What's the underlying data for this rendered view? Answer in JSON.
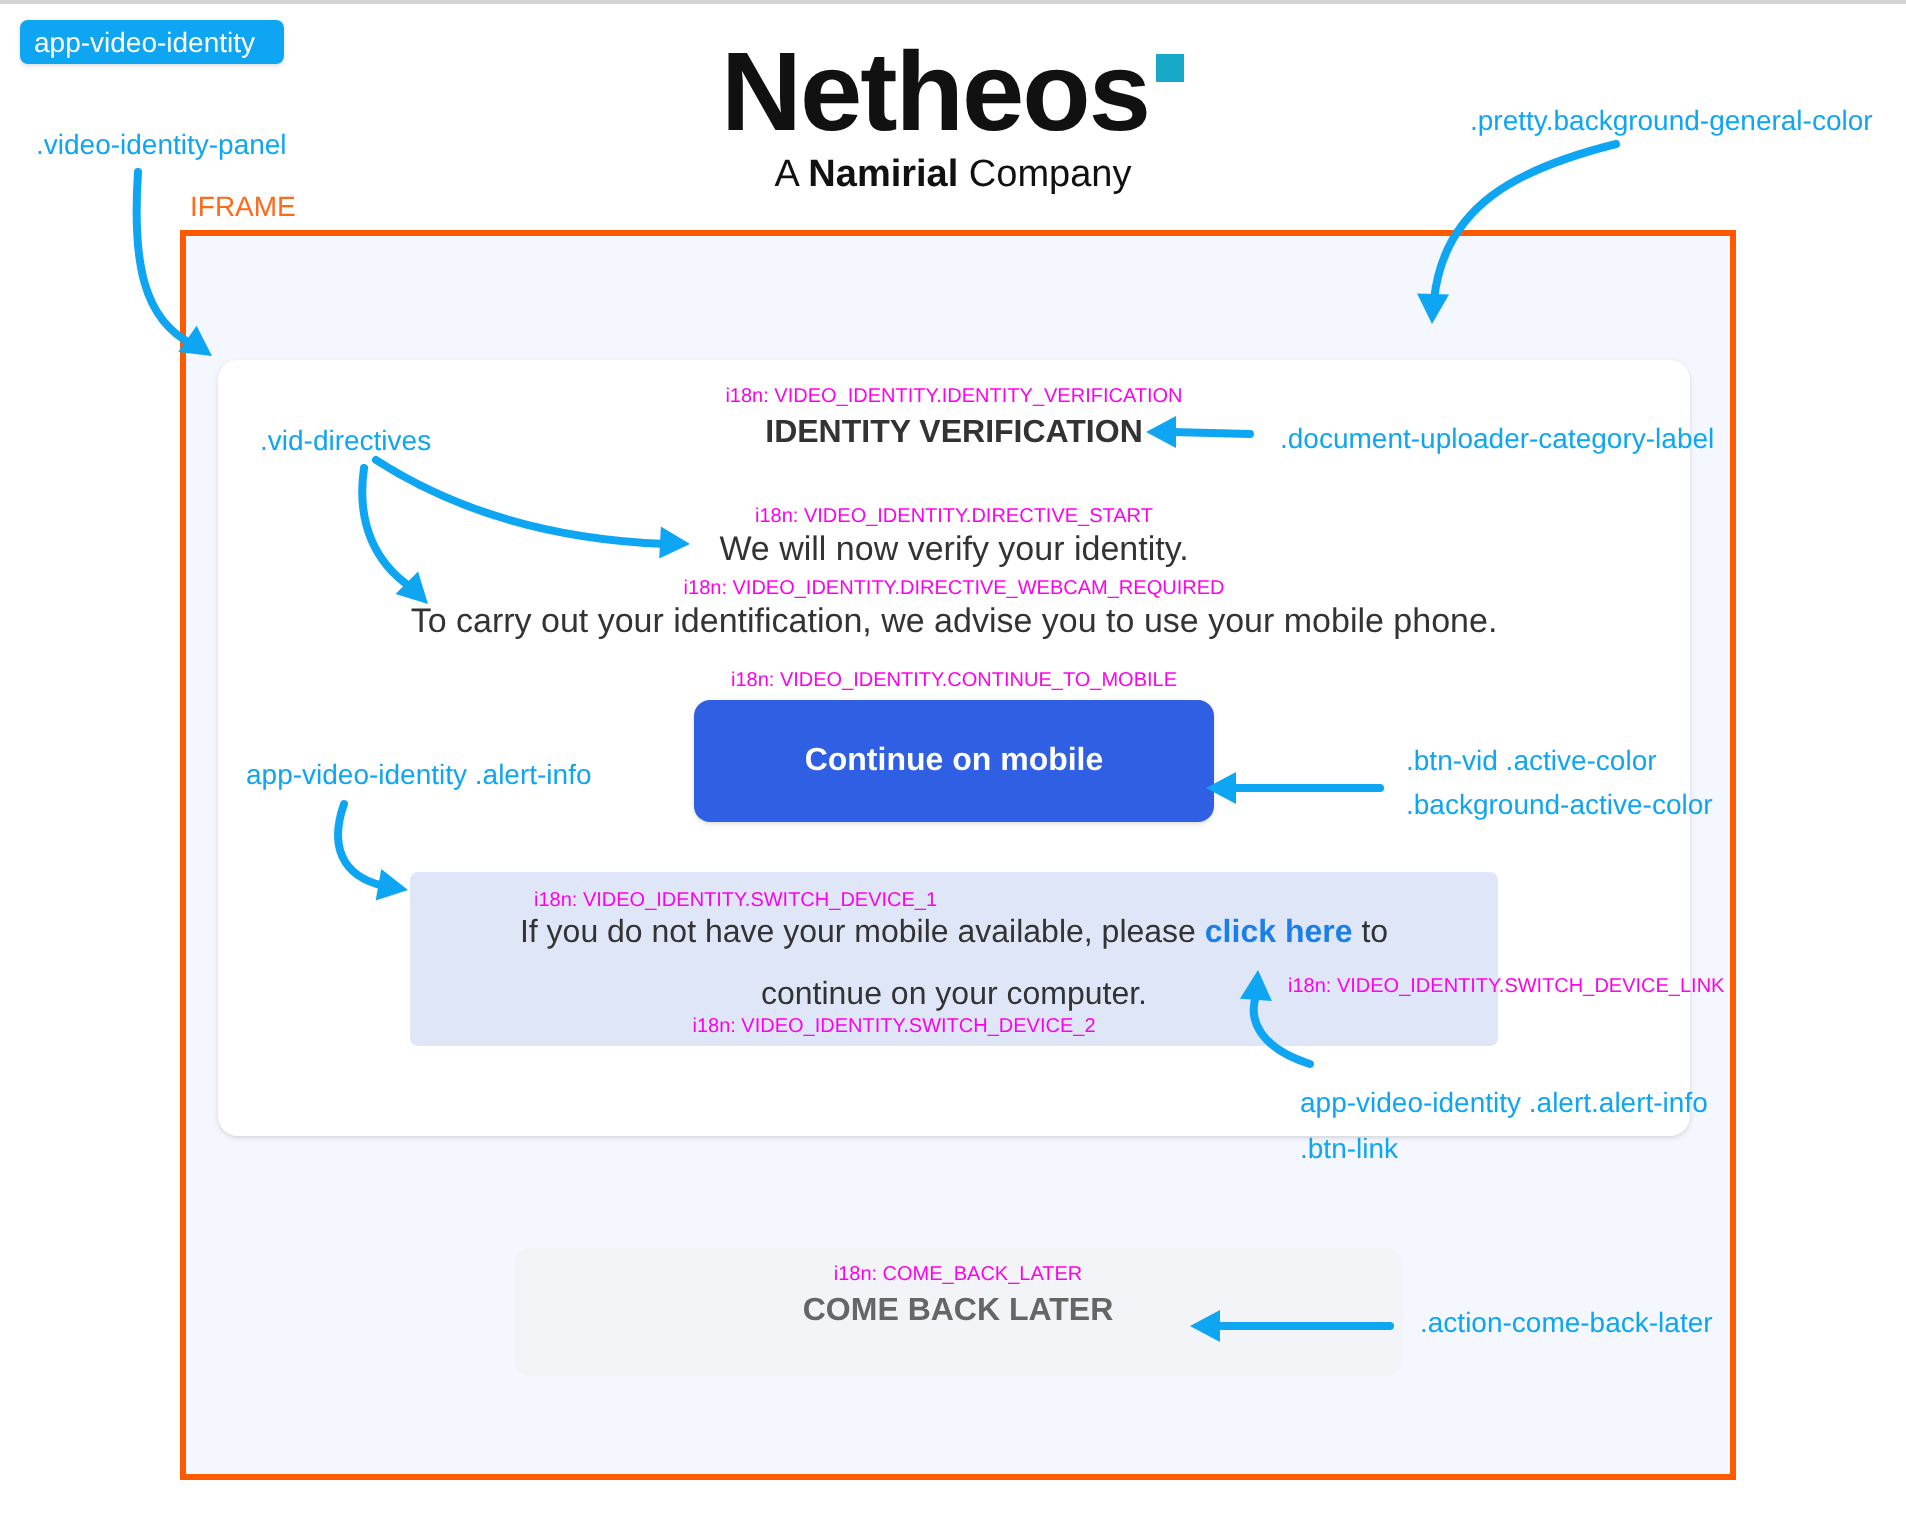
{
  "header": {
    "badge": "app-video-identity",
    "logo": "Netheos",
    "tagline": "A **Namirial** Company"
  },
  "iframe_label": "IFRAME",
  "card": {
    "title_key": "i18n: VIDEO_IDENTITY.IDENTITY_VERIFICATION",
    "title": "IDENTITY VERIFICATION",
    "directives": [
      {
        "key": "i18n: VIDEO_IDENTITY.DIRECTIVE_START",
        "text": "We will now verify your identity."
      },
      {
        "key": "i18n: VIDEO_IDENTITY.DIRECTIVE_WEBCAM_REQUIRED",
        "text": "To carry out your identification, we advise you to use your mobile phone."
      }
    ],
    "button_key": "i18n: VIDEO_IDENTITY.CONTINUE_TO_MOBILE",
    "button": "Continue on mobile",
    "alert": {
      "key_1": "i18n: VIDEO_IDENTITY.SWITCH_DEVICE_1",
      "text_before": "If you do not have your mobile available, please",
      "link": "click here",
      "text_after": "to",
      "text_line_2": "continue on your computer.",
      "key_link": "i18n: VIDEO_IDENTITY.SWITCH_DEVICE_LINK",
      "key_2": "i18n: VIDEO_IDENTITY.SWITCH_DEVICE_2"
    }
  },
  "come_back_later": {
    "key": "i18n: COME_BACK_LATER",
    "text": "COME BACK LATER"
  },
  "annotations": [
    ".video-identity-panel",
    ".pretty.background-general-color",
    ".vid-directives",
    ".document-uploader-category-label",
    "app-video-identity .alert-info",
    ".btn-vid .active-color",
    ".background-active-color",
    "app-video-identity .alert.alert-info",
    ".btn-link",
    ".action-come-back-later"
  ]
}
